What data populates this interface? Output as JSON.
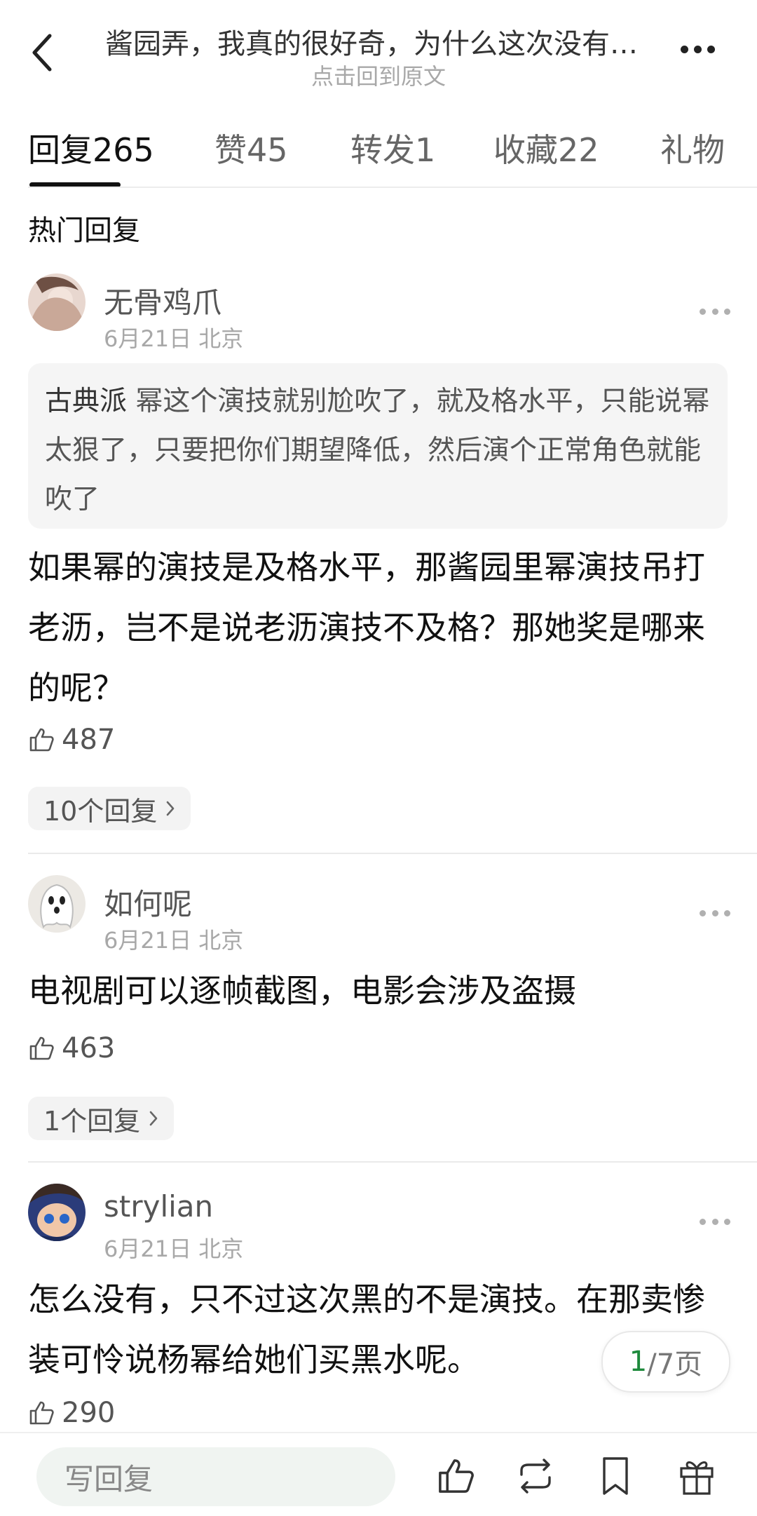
{
  "header": {
    "title": "酱园弄，我真的很好奇，为什么这次没有…",
    "subtitle": "点击回到原文"
  },
  "tabs": [
    {
      "label": "回复",
      "count": "265"
    },
    {
      "label": "赞",
      "count": "45"
    },
    {
      "label": "转发",
      "count": "1"
    },
    {
      "label": "收藏",
      "count": "22"
    },
    {
      "label": "礼物",
      "count": ""
    }
  ],
  "section_title": "热门回复",
  "comments": [
    {
      "username": "无骨鸡爪",
      "meta": "6月21日 北京",
      "quote_author": "古典派",
      "quote_text": " 幂这个演技就别尬吹了，就及格水平，只能说幂太狠了，只要把你们期望降低，然后演个正常角色就能吹了",
      "text": "如果幂的演技是及格水平，那酱园里幂演技吊打老沥，岂不是说老沥演技不及格？那她奖是哪来的呢？",
      "likes": "487",
      "replies": "10个回复"
    },
    {
      "username": "如何呢",
      "meta": "6月21日 北京",
      "text": "电视剧可以逐帧截图，电影会涉及盗摄",
      "likes": "463",
      "replies": "1个回复"
    },
    {
      "username": "strylian",
      "meta": "6月21日 北京",
      "text": "怎么没有，只不过这次黑的不是演技。在那卖惨装可怜说杨幂给她们买黑水呢。",
      "likes": "290"
    }
  ],
  "pagination": {
    "current": "1",
    "total": "/7页"
  },
  "bottom_bar": {
    "reply_placeholder": "写回复"
  },
  "colors": {
    "accent_green": "#1e8a3c",
    "muted": "#a8a8a8"
  }
}
